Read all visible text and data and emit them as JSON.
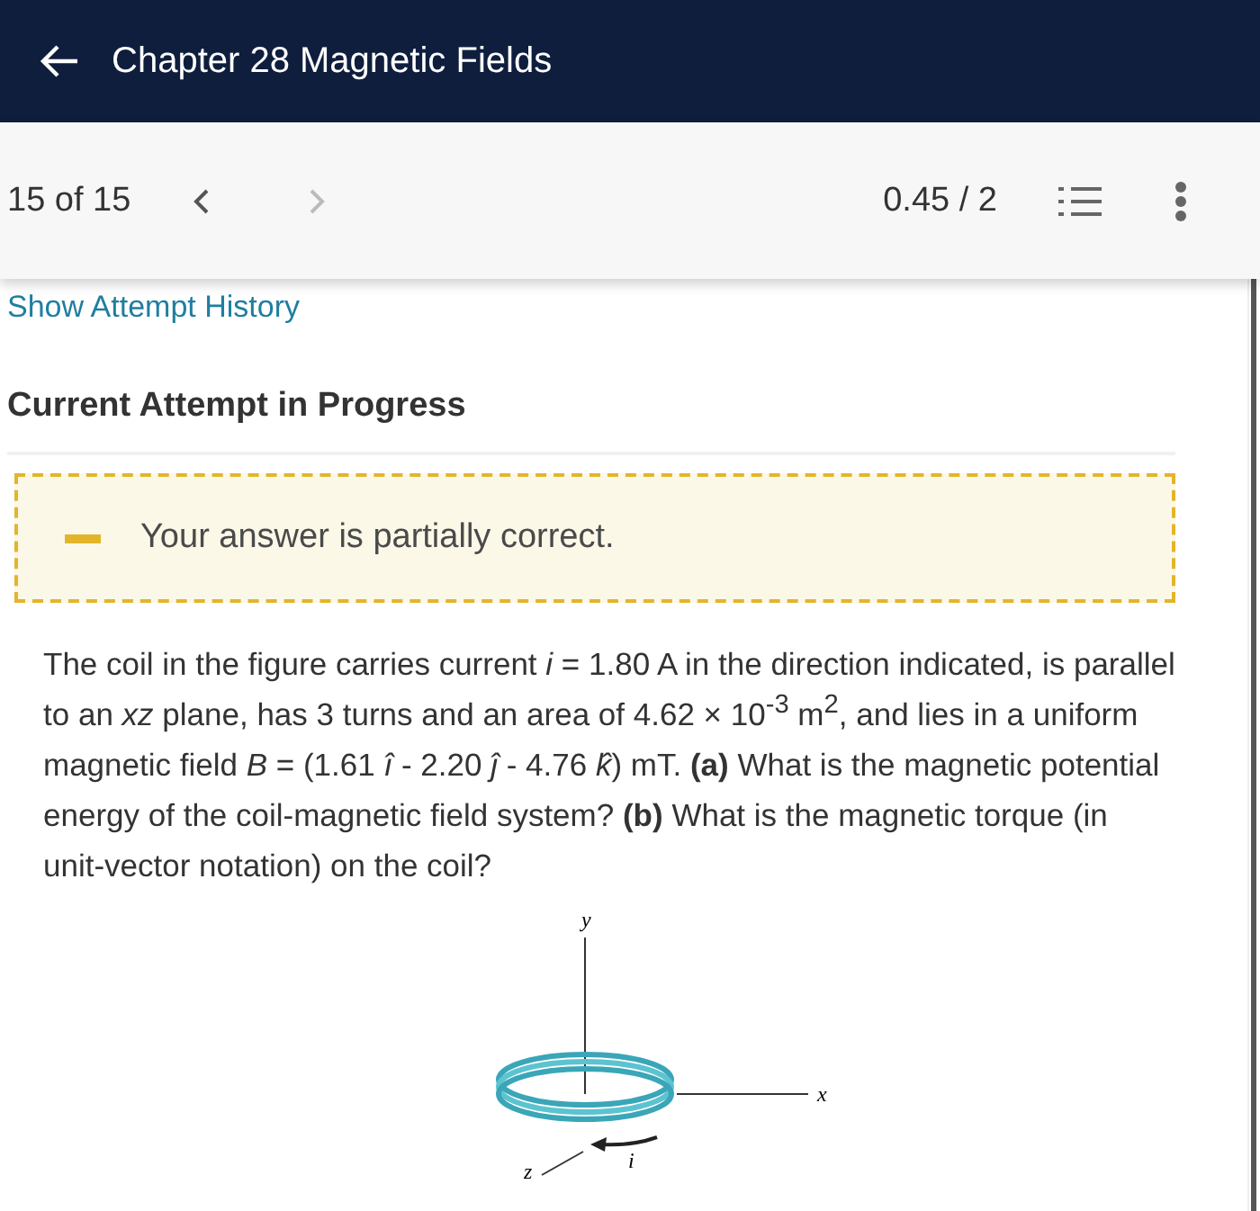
{
  "header": {
    "back_icon": true,
    "title": "Chapter 28 Magnetic Fields"
  },
  "toolbar": {
    "position": "15 of 15",
    "prev_disabled": false,
    "next_disabled": true,
    "score": "0.45 / 2"
  },
  "attempt_history_link": "Show Attempt History",
  "section_title": "Current Attempt in Progress",
  "feedback": {
    "kind": "partial",
    "message": "Your answer is partially correct."
  },
  "question": "The coil in the figure carries current *i* = 1.80 A in the direction indicated, is parallel to an *xz* plane, has 3 turns and an area of 4.62 × 10$^{-3}$ m$^{2}$, and lies in a uniform magnetic field *B* = (1.61 *î* - 2.20 *ĵ* - 4.76 *k̂*) mT. **(a)** What is the magnetic potential energy of the coil-magnetic field system? **(b)** What is the magnetic torque (in unit-vector notation) on the coil?",
  "figure": {
    "y_label": "y",
    "x_label": "x",
    "z_label": "z",
    "current_label": "i"
  }
}
